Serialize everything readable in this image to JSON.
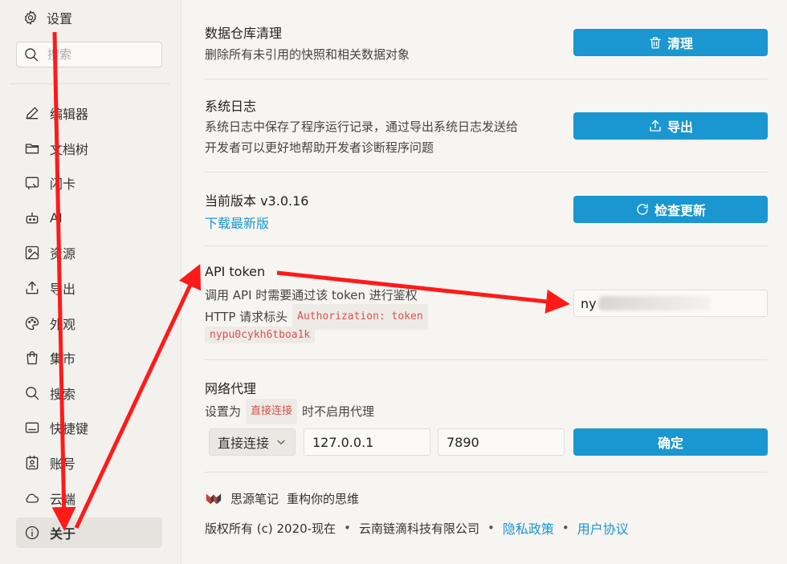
{
  "sidebar": {
    "title": "设置",
    "search_placeholder": "搜索",
    "items": [
      {
        "label": "编辑器",
        "icon": "pencil-icon"
      },
      {
        "label": "文档树",
        "icon": "folder-icon"
      },
      {
        "label": "闪卡",
        "icon": "flashcard-icon"
      },
      {
        "label": "AI",
        "icon": "robot-icon"
      },
      {
        "label": "资源",
        "icon": "image-icon"
      },
      {
        "label": "导出",
        "icon": "upload-icon"
      },
      {
        "label": "外观",
        "icon": "palette-icon"
      },
      {
        "label": "集市",
        "icon": "bag-icon"
      },
      {
        "label": "搜索",
        "icon": "search-icon"
      },
      {
        "label": "快捷键",
        "icon": "keyboard-icon"
      },
      {
        "label": "账号",
        "icon": "account-icon"
      },
      {
        "label": "云端",
        "icon": "cloud-icon"
      },
      {
        "label": "关于",
        "icon": "info-icon",
        "active": true
      }
    ]
  },
  "main": {
    "repo_clean": {
      "title": "数据仓库清理",
      "desc": "删除所有未引用的快照和相关数据对象",
      "button": "清理"
    },
    "syslog": {
      "title": "系统日志",
      "desc1": "系统日志中保存了程序运行记录，通过导出系统日志发送给",
      "desc2": "开发者可以更好地帮助开发者诊断程序问题",
      "button": "导出"
    },
    "version": {
      "title": "当前版本 v3.0.16",
      "download_link": "下载最新版",
      "button": "检查更新"
    },
    "api": {
      "title": "API token",
      "desc1": "调用 API 时需要通过该 token 进行鉴权",
      "desc2_prefix": "HTTP 请求标头",
      "header_code": "Authorization: token",
      "token_code": "nypu0cykh6tboa1k",
      "input_visible": "ny"
    },
    "proxy": {
      "title": "网络代理",
      "desc_prefix": "设置为",
      "desc_code": "直接连接",
      "desc_suffix": "时不启用代理",
      "scheme": "直接连接",
      "host": "127.0.0.1",
      "port": "7890",
      "button": "确定"
    },
    "footer": {
      "brand": "思源笔记",
      "slogan": "重构你的思维",
      "copyright": "版权所有 (c) 2020-现在",
      "company": "云南链滴科技有限公司",
      "privacy": "隐私政策",
      "terms": "用户协议"
    }
  },
  "colors": {
    "accent": "#1a96d0",
    "annotation_arrow": "#ff1a1a"
  }
}
